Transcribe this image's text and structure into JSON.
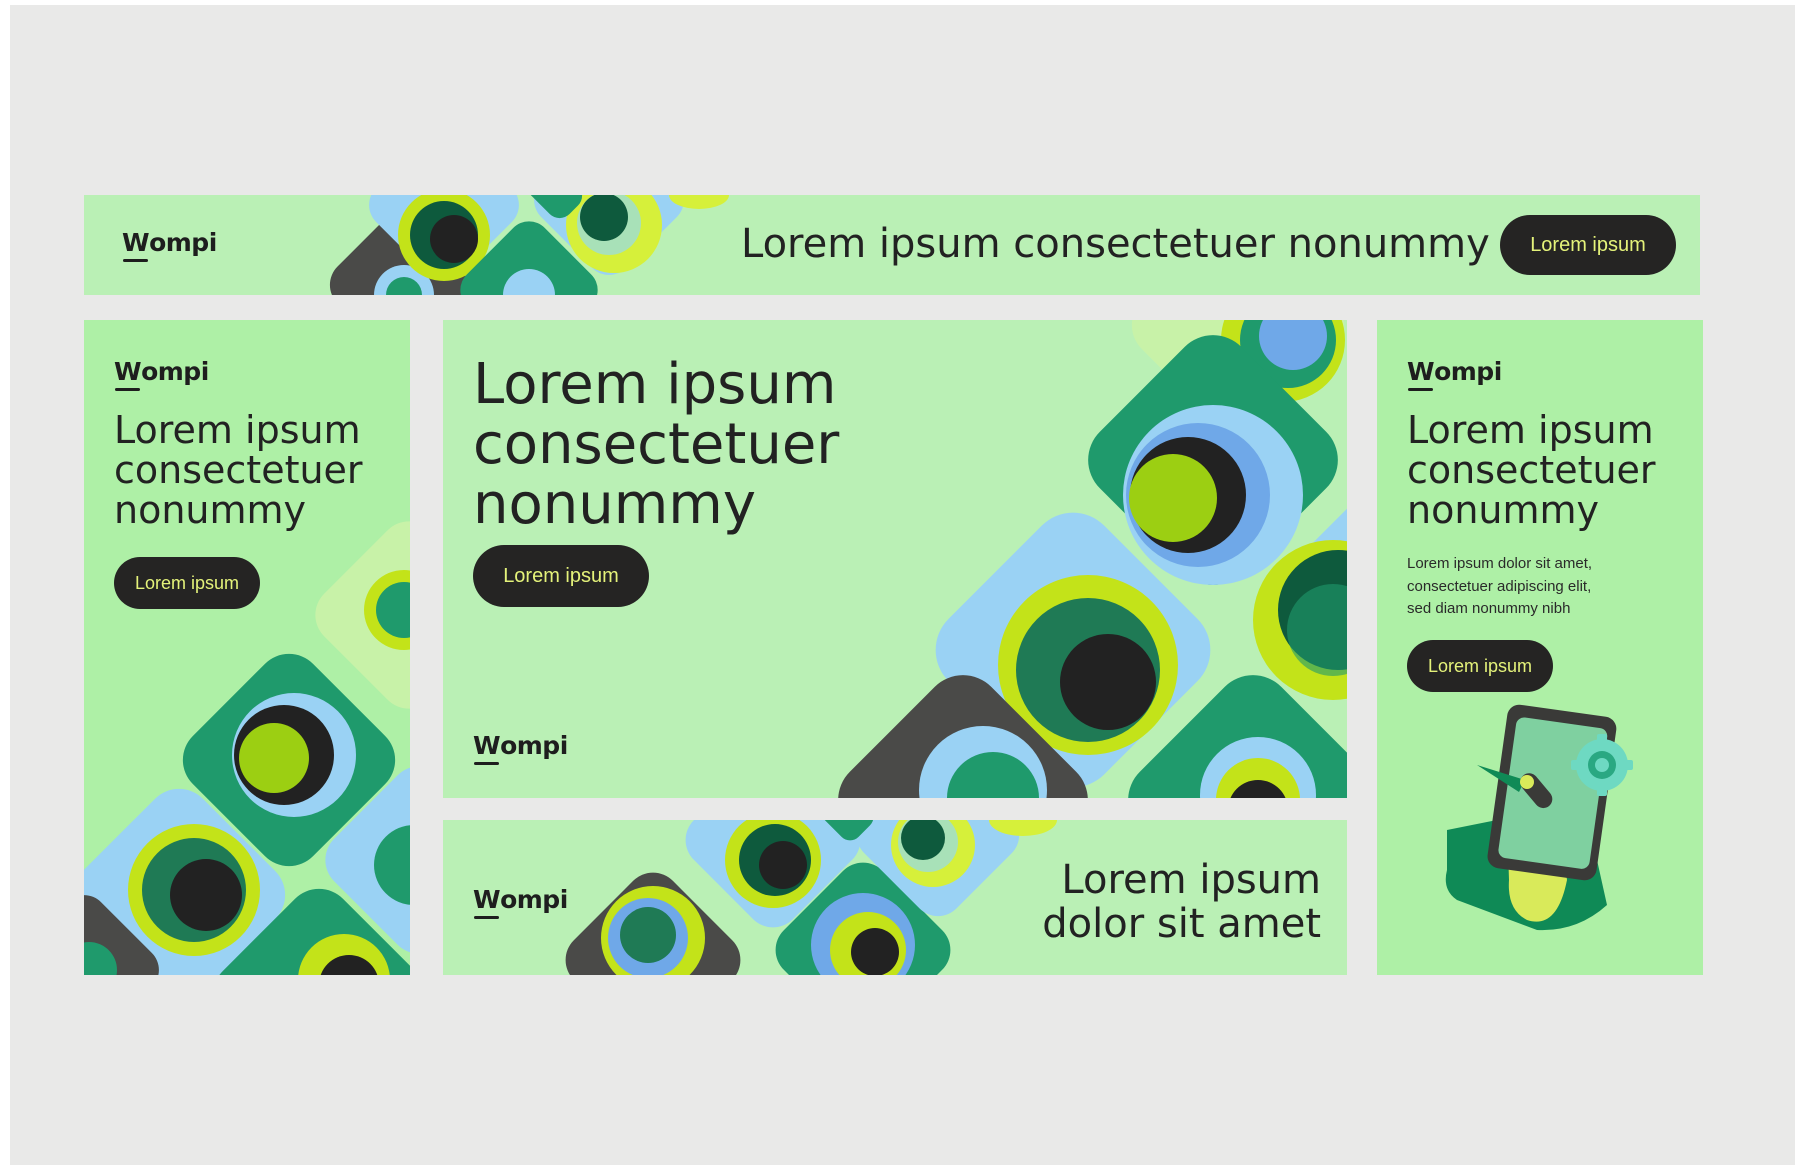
{
  "brand": "Wompi",
  "colors": {
    "bg": "#e9e9e8",
    "banner": "#baf0b5",
    "button": "#252423",
    "button_text": "#e4f27a",
    "tile_blue": "#9ad2f4",
    "tile_green": "#1f9a6c",
    "tile_dark": "#4a4a48",
    "lime": "#c3e319",
    "dark_green": "#0e5a3d"
  },
  "leaderboard": {
    "logo": "Wompi",
    "headline": "Lorem ipsum consectetuer nonummy",
    "button": "Lorem ipsum"
  },
  "skyscraper": {
    "logo": "Wompi",
    "headline_lines": [
      "Lorem ipsum",
      "consectetuer",
      "nonummy"
    ],
    "button": "Lorem ipsum"
  },
  "rectangle": {
    "headline_lines": [
      "Lorem ipsum",
      "consectetuer",
      "nonummy"
    ],
    "button": "Lorem ipsum",
    "logo": "Wompi"
  },
  "bottom_banner": {
    "logo": "Wompi",
    "headline_lines": [
      "Lorem ipsum",
      "dolor sit amet"
    ]
  },
  "side_card": {
    "logo": "Wompi",
    "headline_lines": [
      "Lorem ipsum",
      "consectetuer",
      "nonummy"
    ],
    "body_lines": [
      "Lorem ipsum dolor sit amet,",
      "consectetuer adipiscing elit,",
      "sed diam nonummy nibh"
    ],
    "button": "Lorem ipsum",
    "illustration": "phone-payment-illustration"
  }
}
